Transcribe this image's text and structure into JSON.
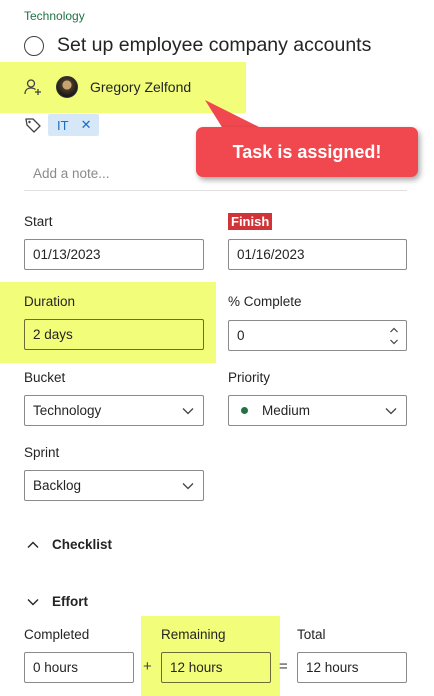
{
  "task": {
    "bucket_label": "Technology",
    "title": "Set up employee company accounts"
  },
  "assignment": {
    "assignee": "Gregory Zelfond"
  },
  "labels": [
    {
      "text": "IT",
      "remove_icon": "close-icon"
    }
  ],
  "callout": {
    "text": "Task is assigned!"
  },
  "note": {
    "placeholder": "Add a note..."
  },
  "dates": {
    "start_label": "Start",
    "start_value": "01/13/2023",
    "finish_label": "Finish",
    "finish_value": "01/16/2023"
  },
  "duration": {
    "label": "Duration",
    "value": "2 days"
  },
  "percent_complete": {
    "label": "% Complete",
    "value": "0"
  },
  "bucket": {
    "label": "Bucket",
    "value": "Technology"
  },
  "priority": {
    "label": "Priority",
    "value": "Medium",
    "dot_color": "#217346"
  },
  "sprint": {
    "label": "Sprint",
    "value": "Backlog"
  },
  "sections": {
    "checklist": "Checklist",
    "effort": "Effort"
  },
  "effort": {
    "completed_label": "Completed",
    "completed_value": "0 hours",
    "plus": "+",
    "remaining_label": "Remaining",
    "remaining_value": "12 hours",
    "equals": "=",
    "total_label": "Total",
    "total_value": "12 hours"
  },
  "colors": {
    "highlight": "#f2fd7a",
    "callout": "#f0484e",
    "finish_badge": "#d13438",
    "label_chip": "#d6e8f8",
    "accent_green": "#217346"
  }
}
